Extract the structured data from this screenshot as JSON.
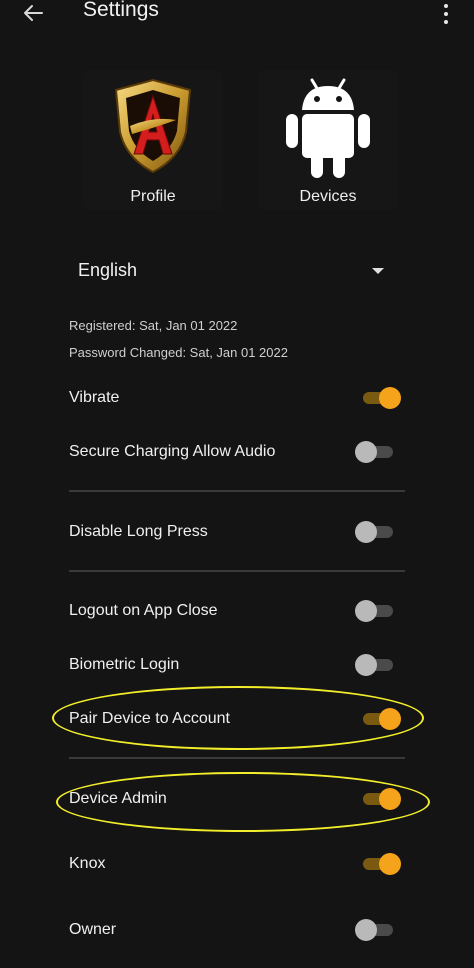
{
  "header": {
    "title": "Settings"
  },
  "tiles": [
    {
      "label": "Profile"
    },
    {
      "label": "Devices"
    }
  ],
  "language": {
    "selected": "English"
  },
  "info": {
    "registered": "Registered: Sat, Jan 01 2022",
    "password_changed": "Password Changed: Sat, Jan 01 2022"
  },
  "settings": [
    {
      "label": "Vibrate",
      "on": true
    },
    {
      "label": "Secure Charging Allow Audio",
      "on": false
    },
    {
      "label": "Disable Long Press",
      "on": false
    },
    {
      "label": "Logout on App Close",
      "on": false
    },
    {
      "label": "Biometric Login",
      "on": false
    },
    {
      "label": "Pair Device to Account",
      "on": true
    },
    {
      "label": "Device Admin",
      "on": true
    },
    {
      "label": "Knox",
      "on": true
    },
    {
      "label": "Owner",
      "on": false
    }
  ],
  "colors": {
    "accent": "#f5a31a",
    "highlight": "#f2ee2b",
    "background": "#141414"
  }
}
